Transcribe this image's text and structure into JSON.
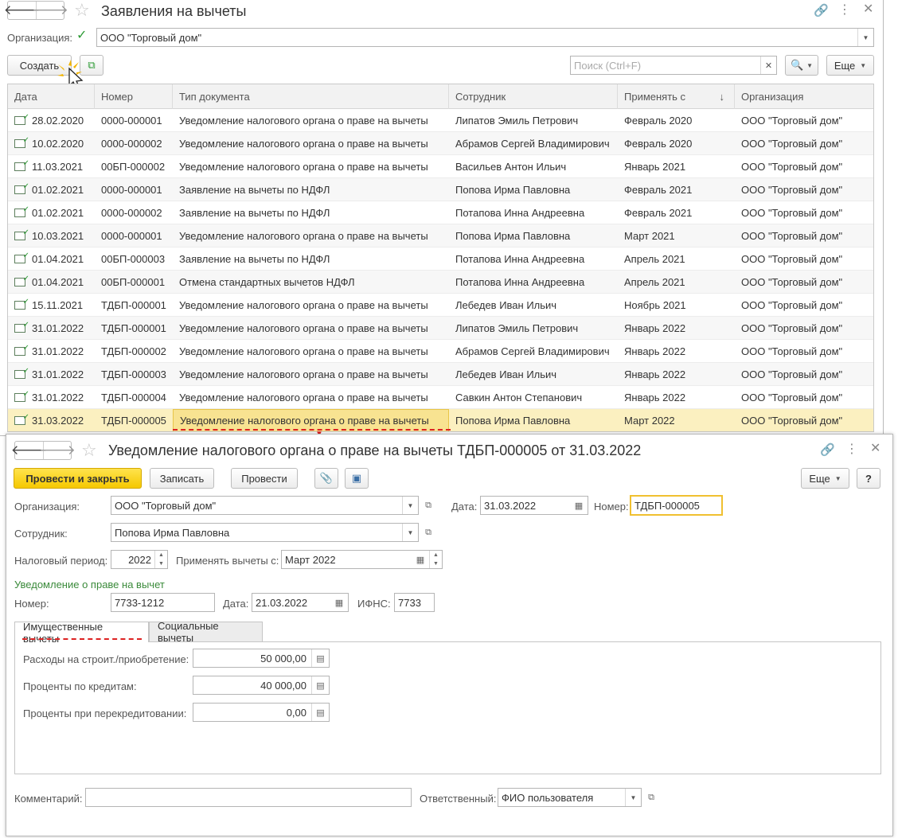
{
  "list_window": {
    "title": "Заявления на вычеты",
    "org_label": "Организация:",
    "org_value": "ООО \"Торговый дом\"",
    "create_label": "Создать",
    "search_placeholder": "Поиск (Ctrl+F)",
    "more_label": "Еще",
    "columns": [
      "Дата",
      "Номер",
      "Тип документа",
      "Сотрудник",
      "Применять с",
      "Организация"
    ],
    "sort_indicator": "↓",
    "rows": [
      {
        "date": "28.02.2020",
        "num": "0000-000001",
        "type": "Уведомление налогового органа о праве на вычеты",
        "emp": "Липатов Эмиль Петрович",
        "from": "Февраль 2020",
        "org": "ООО \"Торговый дом\""
      },
      {
        "date": "10.02.2020",
        "num": "0000-000002",
        "type": "Уведомление налогового органа о праве на вычеты",
        "emp": "Абрамов Сергей Владимирович",
        "from": "Февраль 2020",
        "org": "ООО \"Торговый дом\""
      },
      {
        "date": "11.03.2021",
        "num": "00БП-000002",
        "type": "Уведомление налогового органа о праве на вычеты",
        "emp": "Васильев Антон Ильич",
        "from": "Январь 2021",
        "org": "ООО \"Торговый дом\""
      },
      {
        "date": "01.02.2021",
        "num": "0000-000001",
        "type": "Заявление на вычеты по НДФЛ",
        "emp": "Попова Ирма Павловна",
        "from": "Февраль 2021",
        "org": "ООО \"Торговый дом\""
      },
      {
        "date": "01.02.2021",
        "num": "0000-000002",
        "type": "Заявление на вычеты по НДФЛ",
        "emp": "Потапова Инна Андреевна",
        "from": "Февраль 2021",
        "org": "ООО \"Торговый дом\""
      },
      {
        "date": "10.03.2021",
        "num": "0000-000001",
        "type": "Уведомление налогового органа о праве на вычеты",
        "emp": "Попова Ирма Павловна",
        "from": "Март 2021",
        "org": "ООО \"Торговый дом\""
      },
      {
        "date": "01.04.2021",
        "num": "00БП-000003",
        "type": "Заявление на вычеты по НДФЛ",
        "emp": "Потапова Инна Андреевна",
        "from": "Апрель 2021",
        "org": "ООО \"Торговый дом\""
      },
      {
        "date": "01.04.2021",
        "num": "00БП-000001",
        "type": "Отмена стандартных вычетов НДФЛ",
        "emp": "Потапова Инна Андреевна",
        "from": "Апрель 2021",
        "org": "ООО \"Торговый дом\""
      },
      {
        "date": "15.11.2021",
        "num": "ТДБП-000001",
        "type": "Уведомление налогового органа о праве на вычеты",
        "emp": "Лебедев Иван Ильич",
        "from": "Ноябрь 2021",
        "org": "ООО \"Торговый дом\""
      },
      {
        "date": "31.01.2022",
        "num": "ТДБП-000001",
        "type": "Уведомление налогового органа о праве на вычеты",
        "emp": "Липатов Эмиль Петрович",
        "from": "Январь 2022",
        "org": "ООО \"Торговый дом\""
      },
      {
        "date": "31.01.2022",
        "num": "ТДБП-000002",
        "type": "Уведомление налогового органа о праве на вычеты",
        "emp": "Абрамов Сергей Владимирович",
        "from": "Январь 2022",
        "org": "ООО \"Торговый дом\""
      },
      {
        "date": "31.01.2022",
        "num": "ТДБП-000003",
        "type": "Уведомление налогового органа о праве на вычеты",
        "emp": "Лебедев Иван Ильич",
        "from": "Январь 2022",
        "org": "ООО \"Торговый дом\""
      },
      {
        "date": "31.01.2022",
        "num": "ТДБП-000004",
        "type": "Уведомление налогового органа о праве на вычеты",
        "emp": "Савкин Антон Степанович",
        "from": "Январь 2022",
        "org": "ООО \"Торговый дом\""
      },
      {
        "date": "31.03.2022",
        "num": "ТДБП-000005",
        "type": "Уведомление налогового органа о праве на вычеты",
        "emp": "Попова Ирма Павловна",
        "from": "Март 2022",
        "org": "ООО \"Торговый дом\""
      }
    ]
  },
  "doc_window": {
    "title": "Уведомление налогового органа о праве на вычеты ТДБП-000005 от 31.03.2022",
    "post_close_label": "Провести и закрыть",
    "save_label": "Записать",
    "post_label": "Провести",
    "more_label": "Еще",
    "help_label": "?",
    "org_label": "Организация:",
    "org_value": "ООО \"Торговый дом\"",
    "date_label": "Дата:",
    "date_value": "31.03.2022",
    "num_label": "Номер:",
    "num_value": "ТДБП-000005",
    "emp_label": "Сотрудник:",
    "emp_value": "Попова Ирма Павловна",
    "period_label": "Налоговый период:",
    "period_value": "2022",
    "apply_label": "Применять вычеты с:",
    "apply_value": "Март 2022",
    "section_title": "Уведомление о праве на вычет",
    "notice_num_label": "Номер:",
    "notice_num_value": "7733-1212",
    "notice_date_label": "Дата:",
    "notice_date_value": "21.03.2022",
    "ifns_label": "ИФНС:",
    "ifns_value": "7733",
    "tabs": [
      "Имущественные вычеты",
      "Социальные вычеты"
    ],
    "expenses_label": "Расходы на строит./приобретение:",
    "expenses_value": "50 000,00",
    "interest_label": "Проценты по кредитам:",
    "interest_value": "40 000,00",
    "refinance_label": "Проценты при перекредитовании:",
    "refinance_value": "0,00",
    "comment_label": "Комментарий:",
    "comment_value": "",
    "responsible_label": "Ответственный:",
    "responsible_value": "ФИО пользователя"
  },
  "colors": {
    "accent_green": "#2c9a34",
    "highlight": "#fbf0c0",
    "primary_button": "#f5c800",
    "annotation_red": "#dd2222"
  }
}
